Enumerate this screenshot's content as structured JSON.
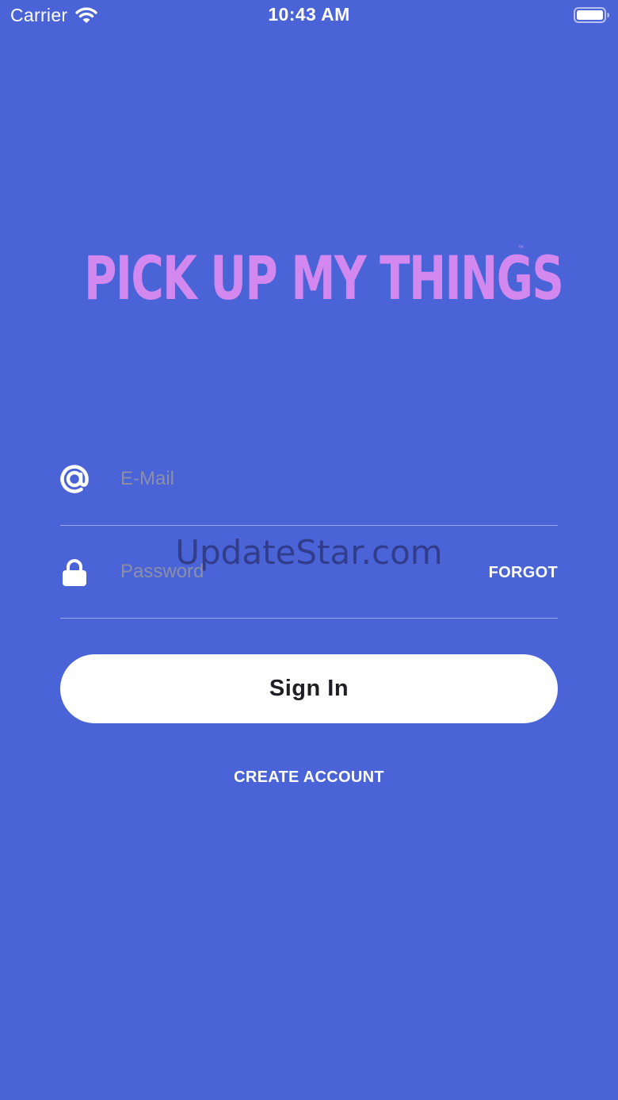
{
  "status_bar": {
    "carrier": "Carrier",
    "time": "10:43 AM",
    "wifi_icon": "wifi-icon",
    "battery_icon": "battery-icon"
  },
  "logo": {
    "text": "PICK UP MY THINGS",
    "trademark": "™",
    "color": "#d288ef"
  },
  "form": {
    "email": {
      "icon": "at-sign-icon",
      "placeholder": "E-Mail",
      "value": ""
    },
    "password": {
      "icon": "lock-icon",
      "placeholder": "Password",
      "value": "",
      "forgot_label": "FORGOT"
    },
    "sign_in_label": "Sign In",
    "create_account_label": "CREATE ACCOUNT"
  },
  "watermark": "UpdateStar.com",
  "colors": {
    "background": "#4a64d8",
    "accent": "#d288ef",
    "button": "#ffffff",
    "button_text": "#1e1e24"
  }
}
